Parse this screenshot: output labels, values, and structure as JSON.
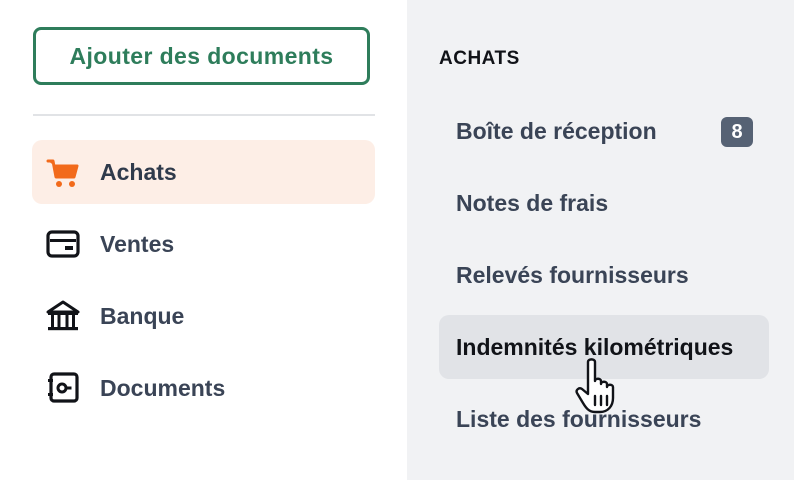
{
  "add_button": {
    "label": "Ajouter des documents"
  },
  "nav": {
    "items": [
      {
        "label": "Achats",
        "icon": "cart-icon",
        "active": true
      },
      {
        "label": "Ventes",
        "icon": "wallet-icon",
        "active": false
      },
      {
        "label": "Banque",
        "icon": "bank-icon",
        "active": false
      },
      {
        "label": "Documents",
        "icon": "safe-icon",
        "active": false
      }
    ]
  },
  "submenu": {
    "title": "ACHATS",
    "items": [
      {
        "label": "Boîte de réception",
        "badge": "8"
      },
      {
        "label": "Notes de frais"
      },
      {
        "label": "Relevés fournisseurs"
      },
      {
        "label": "Indemnités kilométriques",
        "hovered": true
      },
      {
        "label": "Liste des fournisseurs"
      }
    ]
  },
  "colors": {
    "accent_green": "#2e7d5b",
    "accent_orange": "#f26a1b",
    "active_bg": "#fdeee6",
    "panel_bg": "#f1f2f4",
    "badge_bg": "#566274"
  }
}
